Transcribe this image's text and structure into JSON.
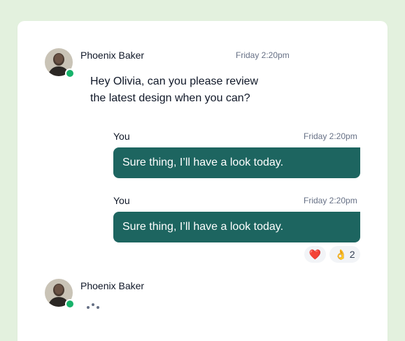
{
  "messages": {
    "incoming": {
      "sender": "Phoenix Baker",
      "time": "Friday 2:20pm",
      "line1": "Hey Olivia, can you please review",
      "line2": "the latest design when you can?"
    },
    "outgoing": [
      {
        "sender": "You",
        "time": "Friday 2:20pm",
        "text": "Sure thing, I’ll have a look today."
      },
      {
        "sender": "You",
        "time": "Friday 2:20pm",
        "text": "Sure thing, I’ll have a look today."
      }
    ],
    "reactions": [
      {
        "emoji": "❤️",
        "icon": "heart-icon"
      },
      {
        "emoji": "👌",
        "count": "2",
        "icon": "ok-hand-icon"
      }
    ],
    "typing": {
      "sender": "Phoenix Baker"
    }
  },
  "colors": {
    "background": "#e3f1de",
    "bubble": "#1d6560",
    "online": "#17b26a"
  }
}
